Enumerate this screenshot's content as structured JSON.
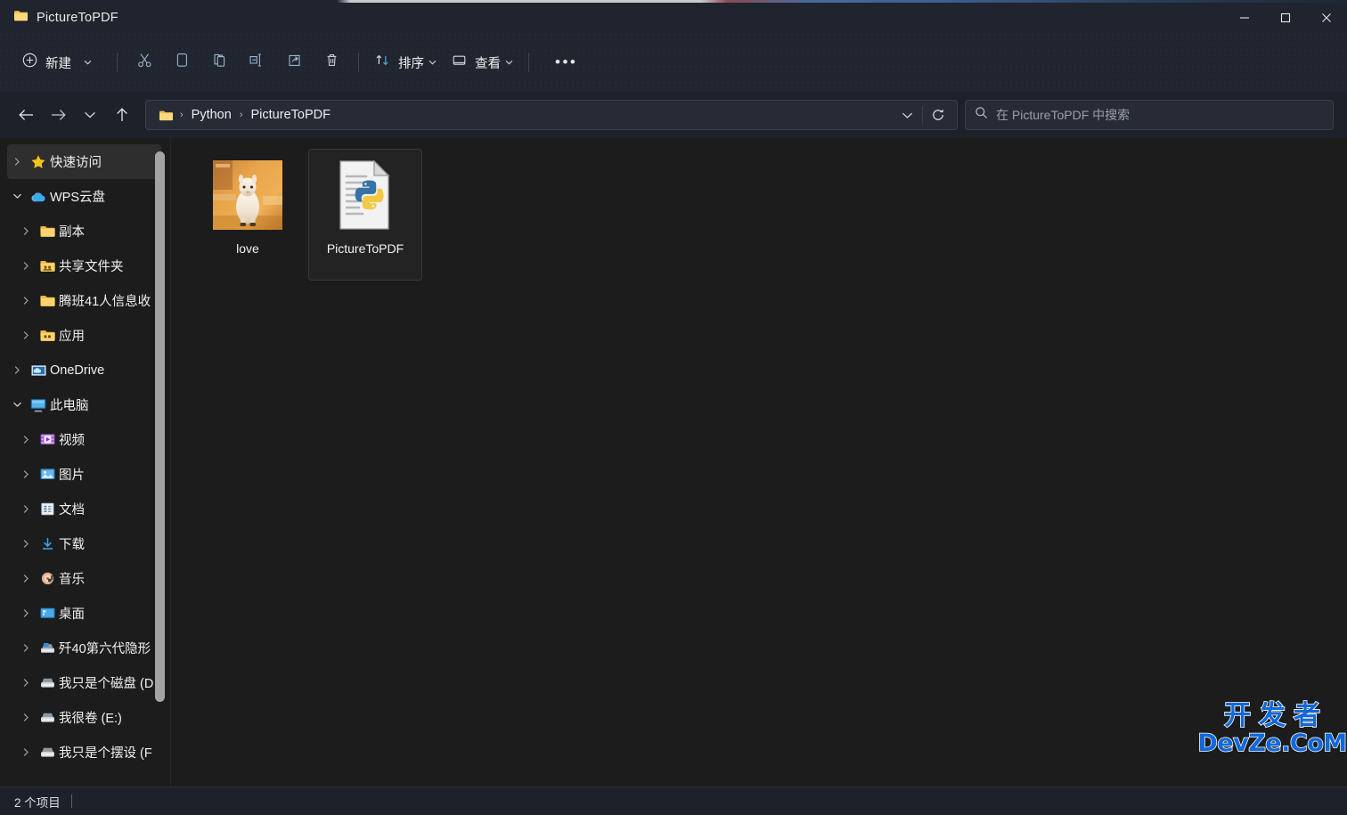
{
  "window": {
    "title": "PictureToPDF",
    "title_icon": "folder-icon",
    "minimize_label": "–",
    "maximize_label": "☐",
    "close_label": "✕"
  },
  "toolbar": {
    "new_label": "新建",
    "new_icon": "plus-circle-icon",
    "cut_icon": "scissors-icon",
    "copy_icon": "copy-icon",
    "paste_icon": "paste-icon",
    "rename_icon": "rename-icon",
    "share_icon": "share-icon",
    "delete_icon": "trash-icon",
    "sort_label": "排序",
    "sort_icon": "sort-arrows-icon",
    "view_label": "查看",
    "view_icon": "view-layout-icon",
    "more_label": "•••",
    "chevron": "⌄"
  },
  "nav": {
    "back_icon": "arrow-left-icon",
    "forward_icon": "arrow-right-icon",
    "recent_icon": "chevron-down-icon",
    "up_icon": "arrow-up-icon",
    "history_icon": "chevron-down-icon",
    "refresh_icon": "refresh-icon"
  },
  "address": {
    "folder_icon": "folder-icon",
    "separator": "›",
    "crumbs": [
      {
        "label": "Python"
      },
      {
        "label": "PictureToPDF"
      }
    ]
  },
  "search": {
    "icon": "search-icon",
    "placeholder": "在 PictureToPDF 中搜索",
    "value": ""
  },
  "sidebar": {
    "items": [
      {
        "label": "快速访问",
        "icon": "star-icon",
        "level": 1,
        "expanded": false,
        "selected": true
      },
      {
        "label": "WPS云盘",
        "icon": "cloud-icon",
        "level": 1,
        "expanded": true,
        "selected": false
      },
      {
        "label": "副本",
        "icon": "folder-icon",
        "level": 2,
        "expanded": false,
        "selected": false
      },
      {
        "label": "共享文件夹",
        "icon": "folder-shared-icon",
        "level": 2,
        "expanded": false,
        "selected": false
      },
      {
        "label": "腾班41人信息收",
        "icon": "folder-icon",
        "level": 2,
        "expanded": false,
        "selected": false
      },
      {
        "label": "应用",
        "icon": "folder-apps-icon",
        "level": 2,
        "expanded": false,
        "selected": false
      },
      {
        "label": "OneDrive",
        "icon": "onedrive-icon",
        "level": 1,
        "expanded": false,
        "selected": false
      },
      {
        "label": "此电脑",
        "icon": "computer-icon",
        "level": 1,
        "expanded": true,
        "selected": false
      },
      {
        "label": "视频",
        "icon": "videos-icon",
        "level": 2,
        "expanded": false,
        "selected": false
      },
      {
        "label": "图片",
        "icon": "pictures-icon",
        "level": 2,
        "expanded": false,
        "selected": false
      },
      {
        "label": "文档",
        "icon": "documents-icon",
        "level": 2,
        "expanded": false,
        "selected": false
      },
      {
        "label": "下载",
        "icon": "downloads-icon",
        "level": 2,
        "expanded": false,
        "selected": false
      },
      {
        "label": "音乐",
        "icon": "music-icon",
        "level": 2,
        "expanded": false,
        "selected": false
      },
      {
        "label": "桌面",
        "icon": "desktop-icon",
        "level": 2,
        "expanded": false,
        "selected": false
      },
      {
        "label": "歼40第六代隐形",
        "icon": "local-disk-icon",
        "level": 2,
        "expanded": false,
        "selected": false
      },
      {
        "label": "我只是个磁盘 (D",
        "icon": "drive-icon",
        "level": 2,
        "expanded": false,
        "selected": false
      },
      {
        "label": "我很卷 (E:)",
        "icon": "drive-icon",
        "level": 2,
        "expanded": false,
        "selected": false
      },
      {
        "label": "我只是个摆设 (F",
        "icon": "drive-icon",
        "level": 2,
        "expanded": false,
        "selected": false
      }
    ]
  },
  "files": [
    {
      "name": "love",
      "type": "image-thumbnail",
      "selected": false
    },
    {
      "name": "PictureToPDF",
      "type": "python-file",
      "selected": true
    }
  ],
  "status": {
    "item_count": "2 个项目"
  },
  "watermark": {
    "line1": "开发者",
    "line2": "DevZe.CoM",
    "color": "#1168d9"
  }
}
